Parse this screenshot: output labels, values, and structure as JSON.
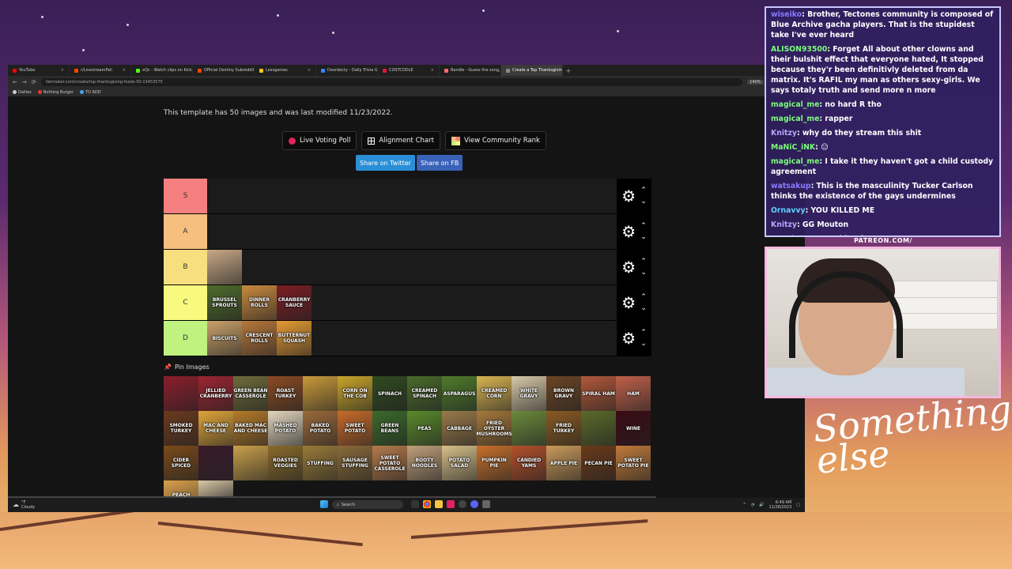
{
  "browser": {
    "tabs": [
      {
        "label": "YouTube",
        "color": "#ff0000"
      },
      {
        "label": "r/LivestreamFail",
        "color": "#ff4500"
      },
      {
        "label": "xQc - Watch clips on Kick",
        "color": "#53fc18"
      },
      {
        "label": "Official Destiny Subreddit",
        "color": "#ff4500"
      },
      {
        "label": "Lessgames",
        "color": "#f5c518"
      },
      {
        "label": "Doordecty - Daily Trivia Game",
        "color": "#3b82f6"
      },
      {
        "label": "COSTCODLE",
        "color": "#e31837"
      },
      {
        "label": "Bandle - Guess the song, one ins",
        "color": "#ff6b6b"
      },
      {
        "label": "Create a Top Thanksgiving Foo",
        "color": "#888888",
        "active": true
      }
    ],
    "url": "tiermaker.com/create/top-thanksgiving-foods-50-15453575",
    "zoom": "140%",
    "bookmarks": [
      {
        "label": "Dailies",
        "color": "#cccccc"
      },
      {
        "label": "Nothing Burger",
        "color": "#e53935"
      },
      {
        "label": "TO ADD",
        "color": "#42a5f5"
      }
    ]
  },
  "page": {
    "info_text": "This template has 50 images and was last modified 11/23/2022.",
    "buttons": {
      "live_voting": "Live Voting Poll",
      "alignment_chart": "Alignment Chart",
      "community_rank": "View Community Rank",
      "share_twitter": "Share on Twitter",
      "share_fb": "Share on FB"
    },
    "tiers": [
      {
        "label": "S",
        "color": "#f47f7f",
        "items": []
      },
      {
        "label": "A",
        "color": "#f6bf7f",
        "items": []
      },
      {
        "label": "B",
        "color": "#f7df7f",
        "items": [
          {
            "text": "",
            "bg": "#c9a887"
          }
        ]
      },
      {
        "label": "C",
        "color": "#f8f97f",
        "items": [
          {
            "text": "BRUSSEL SPROUTS",
            "bg": "#4e6b2d"
          },
          {
            "text": "DINNER ROLLS",
            "bg": "#c88a3e"
          },
          {
            "text": "CRANBERRY SAUCE",
            "bg": "#7a1d22"
          }
        ]
      },
      {
        "label": "D",
        "color": "#bff27f",
        "items": [
          {
            "text": "BISCUITS",
            "bg": "#caa16a"
          },
          {
            "text": "CRESCENT ROLLS",
            "bg": "#b6773a"
          },
          {
            "text": "BUTTERNUT SQUASH",
            "bg": "#e59a34"
          }
        ]
      }
    ],
    "pin_title": "Pin Images",
    "pin_items": [
      {
        "text": "",
        "bg": "#8b1e2b"
      },
      {
        "text": "JELLIED CRANBERRY",
        "bg": "#9c2430"
      },
      {
        "text": "GREEN BEAN CASSEROLE",
        "bg": "#6d6b3a"
      },
      {
        "text": "ROAST TURKEY",
        "bg": "#8a4a22"
      },
      {
        "text": "",
        "bg": "#c99a3a"
      },
      {
        "text": "CORN ON THE COB",
        "bg": "#c9a52a"
      },
      {
        "text": "SPINACH",
        "bg": "#2f4a20"
      },
      {
        "text": "CREAMED SPINACH",
        "bg": "#4a6a2a"
      },
      {
        "text": "ASPARAGUS",
        "bg": "#4f7a2c"
      },
      {
        "text": "CREAMED CORN",
        "bg": "#d9b451"
      },
      {
        "text": "WHITE GRAVY",
        "bg": "#d7c9a8"
      },
      {
        "text": "BROWN GRAVY",
        "bg": "#6b4423"
      },
      {
        "text": "SPIRAL HAM",
        "bg": "#b1583a"
      },
      {
        "text": "HAM",
        "bg": "#c0604a"
      },
      {
        "text": "SMOKED TURKEY",
        "bg": "#6a3a1e"
      },
      {
        "text": "MAC AND CHEESE",
        "bg": "#e0a53a"
      },
      {
        "text": "BAKED MAC AND CHEESE",
        "bg": "#b47a2a"
      },
      {
        "text": "MASHED POTATO",
        "bg": "#e2d6be"
      },
      {
        "text": "BAKED POTATO",
        "bg": "#9a6a3a"
      },
      {
        "text": "SWEET POTATO",
        "bg": "#c86a2a"
      },
      {
        "text": "GREEN BEANS",
        "bg": "#3a6a2a"
      },
      {
        "text": "PEAS",
        "bg": "#5a8a2a"
      },
      {
        "text": "CABBAGE",
        "bg": "#9a7a4a"
      },
      {
        "text": "FRIED OYSTER MUSHROOMS",
        "bg": "#a5783a"
      },
      {
        "text": "",
        "bg": "#6a8a3a"
      },
      {
        "text": "FRIED TURKEY",
        "bg": "#8a5a22"
      },
      {
        "text": "",
        "bg": "#5a6a2a"
      },
      {
        "text": "WINE",
        "bg": "#3a0a14"
      },
      {
        "text": "CIDER SPICED",
        "bg": "#7a4a1a"
      },
      {
        "text": "",
        "bg": "#3a1a2a"
      },
      {
        "text": "",
        "bg": "#c9a04a"
      },
      {
        "text": "ROASTED VEGGIES",
        "bg": "#8a6a2a"
      },
      {
        "text": "STUFFING",
        "bg": "#9a7a3a"
      },
      {
        "text": "SAUSAGE STUFFING",
        "bg": "#8a6a3a"
      },
      {
        "text": "SWEET POTATO CASSEROLE",
        "bg": "#b47a4a"
      },
      {
        "text": "BOOTY NOODLES",
        "bg": "#c0a07a"
      },
      {
        "text": "POTATO SALAD",
        "bg": "#d6c08a"
      },
      {
        "text": "PUMPKIN PIE",
        "bg": "#c9702a"
      },
      {
        "text": "CANDIED YAMS",
        "bg": "#b4502a"
      },
      {
        "text": "APPLE PIE",
        "bg": "#c99a5a"
      },
      {
        "text": "PECAN PIE",
        "bg": "#6a3a1a"
      },
      {
        "text": "SWEET POTATO PIE",
        "bg": "#c07a3a"
      },
      {
        "text": "PEACH COBBLER",
        "bg": "#d9a04a"
      },
      {
        "text": "",
        "bg": "#d9c9a8",
        "half": true
      }
    ]
  },
  "taskbar": {
    "weather_temp": "°F",
    "weather_cond": "Cloudy",
    "search_placeholder": "Search",
    "time": "6:49 AM",
    "date": "11/28/2023"
  },
  "chat": {
    "messages": [
      {
        "user": "wiseiko",
        "user_color": "#8a7bff",
        "text": "Brother, Tectones community is composed of Blue Archive gacha players. That is the stupidest take I've ever heard"
      },
      {
        "user": "ALISON93500",
        "user_color": "#7cfc7c",
        "text": "Forget All about other clowns and their bulshit effect that everyone hated, It stopped because they'r been definitivly deleted from da matrix. It's RAFIL my man as others sexy-girls. We says totaly truth and send more n more"
      },
      {
        "user": "magical_me",
        "user_color": "#7cfc7c",
        "text": "no hard R tho"
      },
      {
        "user": "magical_me",
        "user_color": "#7cfc7c",
        "text": "rapper"
      },
      {
        "user": "Knitzy",
        "user_color": "#b7a6ff",
        "text": "why do they stream this shit"
      },
      {
        "user": "MaNiC_iNK",
        "user_color": "#7cfc7c",
        "text": "😑"
      },
      {
        "user": "magical_me",
        "user_color": "#7cfc7c",
        "text": "I take it they haven't got a child custody  agreement "
      },
      {
        "user": "watsakup",
        "user_color": "#8a7bff",
        "text": "This is the masculinity Tucker Carlson thinks the existence of the gays undermines"
      },
      {
        "user": "Ornavvy",
        "user_color": "#5fd0ff",
        "text": "YOU KILLED ME"
      },
      {
        "user": "Knitzy",
        "user_color": "#b7a6ff",
        "text": "GG Mouton"
      },
      {
        "user": "SneakyToe",
        "user_color": "#5fd0ff",
        "text": "KFC biscuits"
      }
    ]
  },
  "overlay": {
    "patreon": "PATREON.COM/",
    "brand": "Something else"
  }
}
